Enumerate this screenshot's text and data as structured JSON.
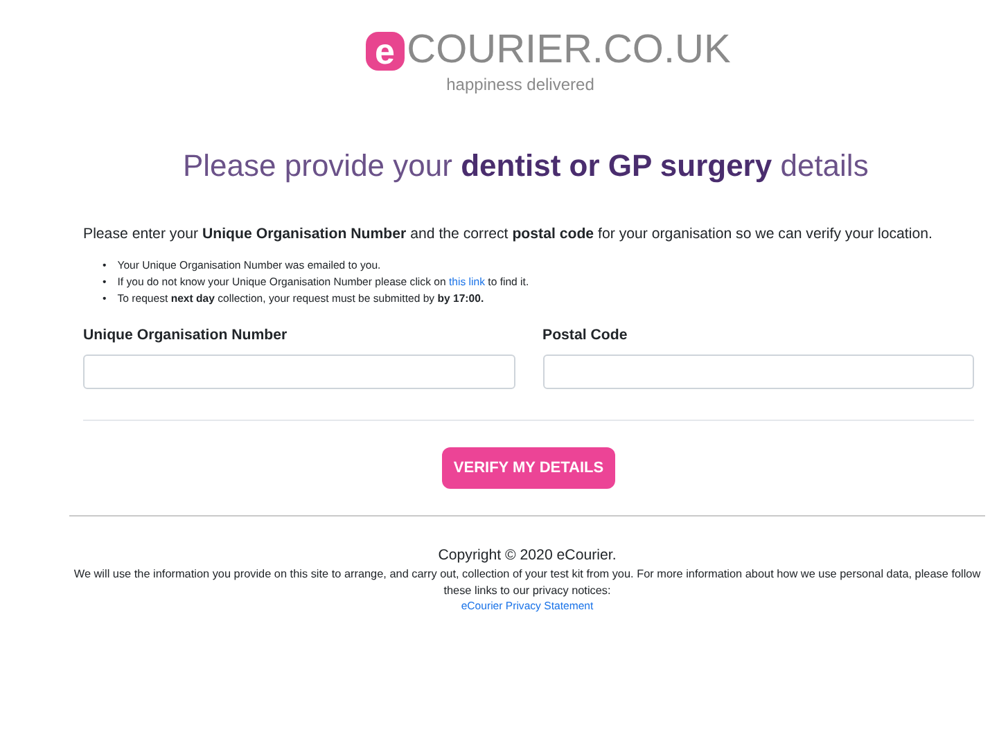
{
  "logo": {
    "mark": "e",
    "name": "COURIER.CO.UK",
    "tagline": "happiness delivered"
  },
  "heading": "Please provide your **dentist or GP surgery** details",
  "intro": "Please enter your **Unique Organisation Number** and the correct **postal code** for your organisation so we can verify your location.",
  "notes": [
    {
      "kind": "text",
      "bullet": "•",
      "text": "Your Unique Organisation Number was emailed to you."
    },
    {
      "kind": "link",
      "bullet": "•",
      "before": "If you do not know your Unique Organisation Number please click on",
      "link": "this link",
      "after": "to find it."
    },
    {
      "kind": "text",
      "bullet": "•",
      "text": "To request **next day** collection, your request must be submitted by **by 17:00.**"
    }
  ],
  "fields": [
    {
      "label": "Unique Organisation Number"
    },
    {
      "label": "Postal Code"
    }
  ],
  "submit": "VERIFY MY DETAILS",
  "footer": {
    "copyright": "Copyright © 2020 eCourier.",
    "notice": "We will use the information you provide on this site to arrange, and carry out, collection of your test kit from you. For more information about how we use personal data, please follow these links to our privacy notices:",
    "link": "eCourier Privacy Statement"
  }
}
